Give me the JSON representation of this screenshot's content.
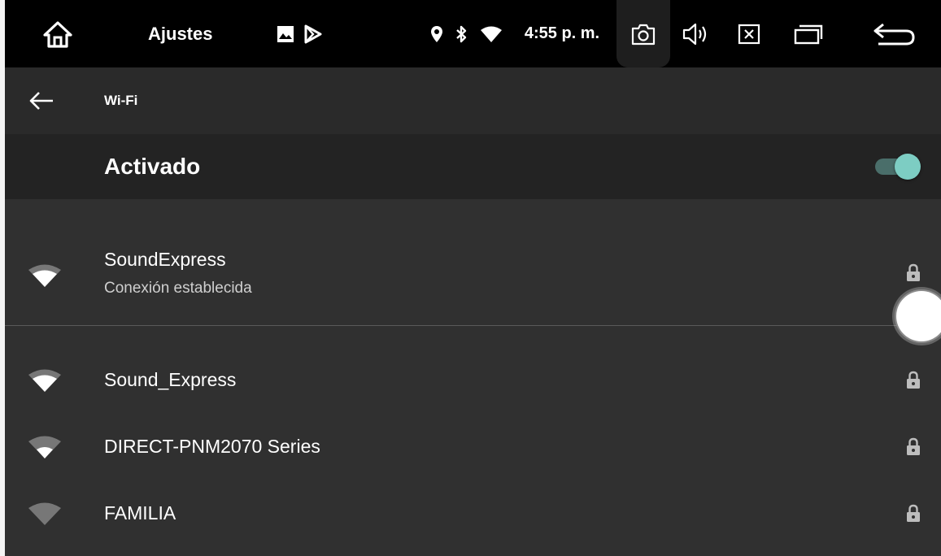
{
  "statusbar": {
    "app_title": "Ajustes",
    "time": "4:55 p. m.",
    "icons": [
      "home-icon",
      "gallery-icon",
      "play-store-icon",
      "location-icon",
      "bluetooth-icon",
      "wifi-signal-icon",
      "screenshot-icon",
      "volume-icon",
      "close-window-icon",
      "recent-apps-icon",
      "back-icon"
    ]
  },
  "toolbar": {
    "title": "Wi-Fi"
  },
  "master": {
    "label": "Activado",
    "enabled": true
  },
  "networks": [
    {
      "ssid": "SoundExpress",
      "status": "Conexión establecida",
      "secured": true
    },
    {
      "ssid": "Sound_Express",
      "status": "",
      "secured": true
    },
    {
      "ssid": "DIRECT-PNM2070 Series",
      "status": "",
      "secured": true
    },
    {
      "ssid": "FAMILIA",
      "status": "",
      "secured": true
    }
  ],
  "colors": {
    "accent": "#7dcdc3",
    "background": "#303030",
    "statusbar": "#000000"
  }
}
